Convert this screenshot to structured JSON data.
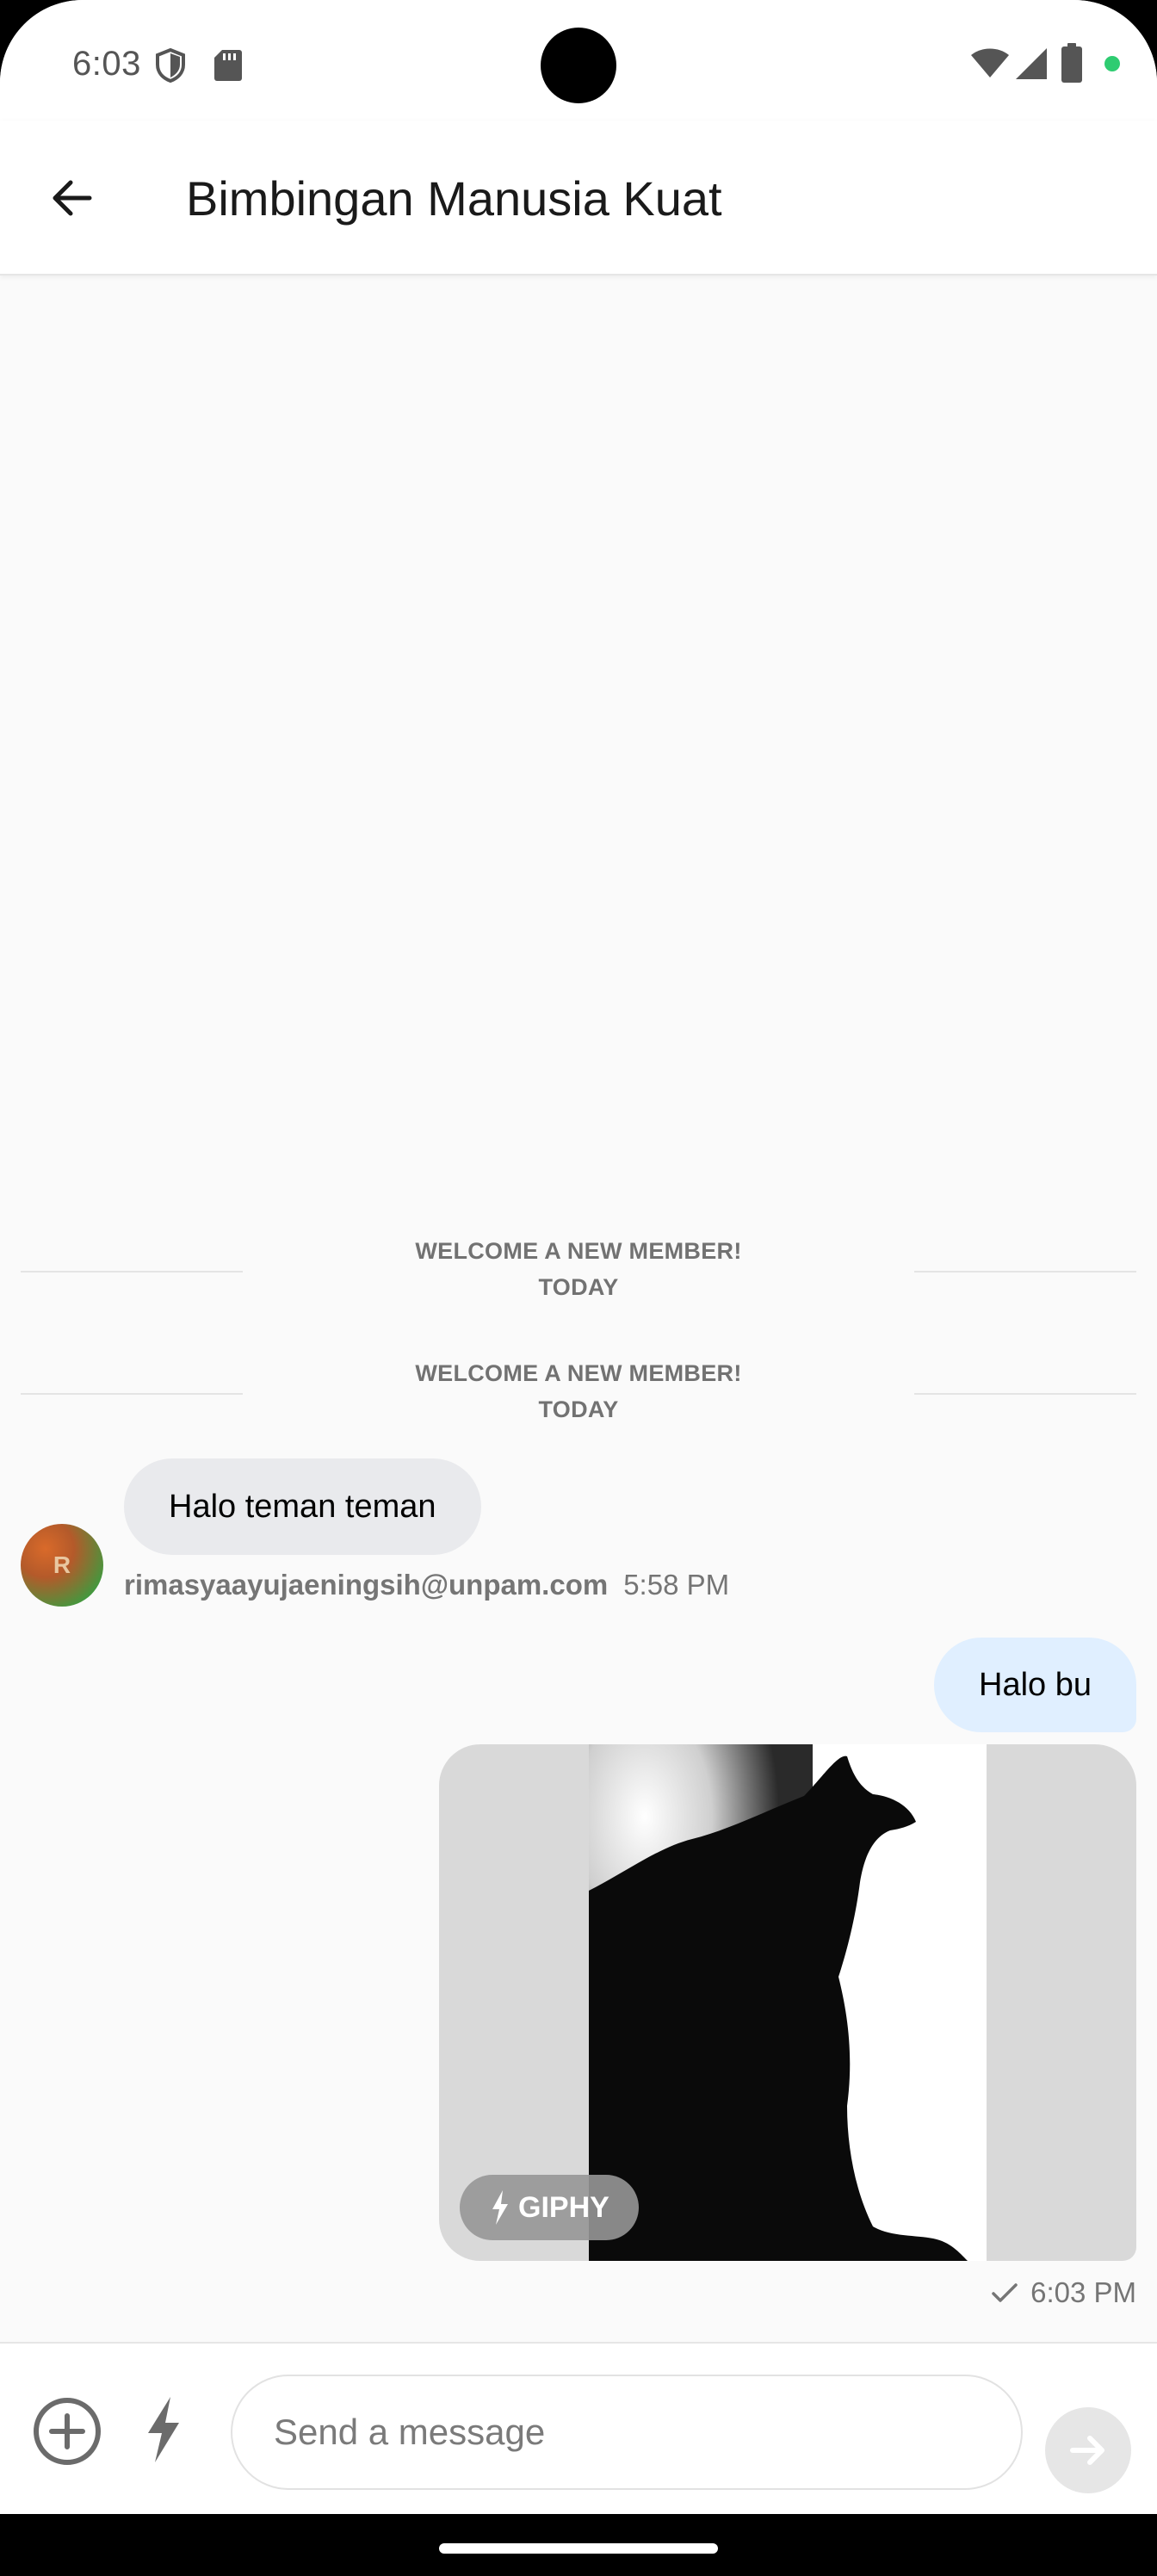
{
  "status_bar": {
    "time": "6:03",
    "icons": [
      "shield-icon",
      "sd-card-icon",
      "wifi-icon",
      "signal-icon",
      "battery-icon",
      "dot-indicator"
    ],
    "indicator_color": "#2ecc71"
  },
  "header": {
    "title": "Bimbingan Manusia Kuat",
    "back_icon": "arrow-left-icon"
  },
  "system_messages": [
    {
      "line1": "WELCOME A NEW MEMBER!",
      "line2": "TODAY"
    },
    {
      "line1": "WELCOME A NEW MEMBER!",
      "line2": "TODAY"
    }
  ],
  "messages": {
    "incoming": {
      "text": "Halo teman teman",
      "avatar_initial": "R",
      "user": "rimasyaayujaeningsih@unpam.com",
      "time": "5:58 PM"
    },
    "outgoing": {
      "text": "Halo bu",
      "gif_badge": "GIPHY",
      "time": "6:03 PM",
      "status_icon": "check-icon"
    }
  },
  "composer": {
    "placeholder": "Send a message",
    "value": "",
    "attach_icon": "plus-circle-icon",
    "commands_icon": "bolt-icon",
    "send_icon": "send-arrow-icon"
  },
  "colors": {
    "incoming_bubble": "#e9eaed",
    "outgoing_bubble": "#e0efff",
    "background": "#fafafa"
  }
}
